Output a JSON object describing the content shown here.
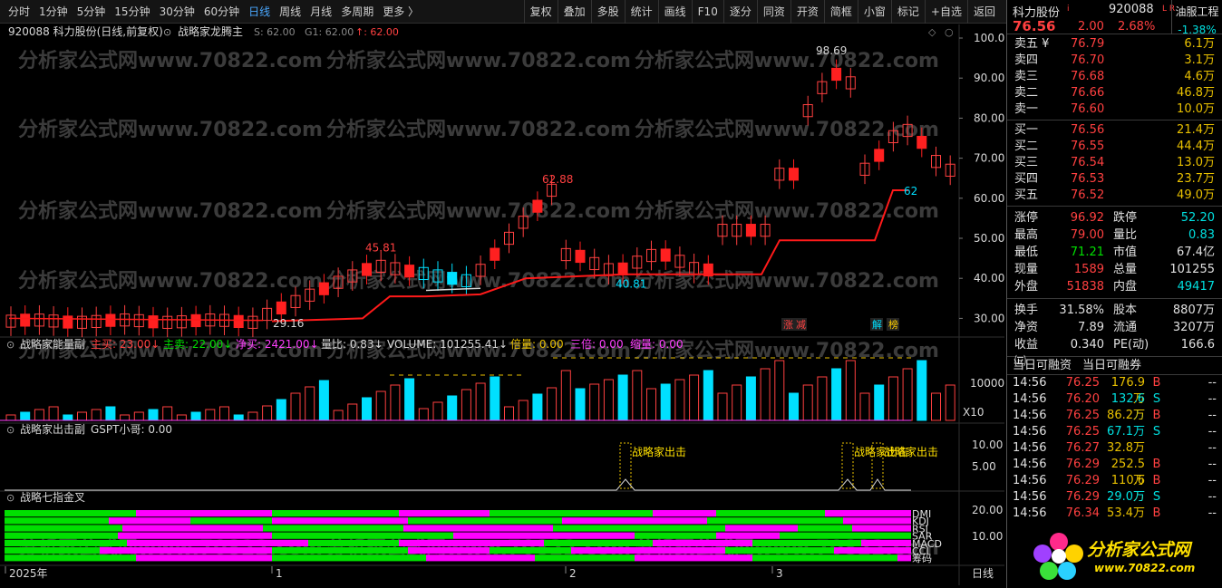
{
  "toolbar": {
    "left": [
      "分时",
      "1分钟",
      "5分钟",
      "15分钟",
      "30分钟",
      "60分钟",
      "日线",
      "周线",
      "月线",
      "多周期",
      "更多 〉"
    ],
    "active": 6,
    "right": [
      "复权",
      "叠加",
      "多股",
      "统计",
      "画线",
      "F10",
      "逐分",
      "同资",
      "开资",
      "简框",
      "小窗",
      "标记",
      "+自选",
      "返回"
    ]
  },
  "price_panel": {
    "header": "920088 科力股份(日线,前复权)",
    "indicator": "战略家龙腾主",
    "header_vals": [
      "S: 62.00",
      "G1: 62.00"
    ],
    "header_red": "↑: 62.00",
    "y_ticks": [
      "100.0",
      "90.00",
      "80.00",
      "70.00",
      "60.00",
      "50.00",
      "40.00",
      "30.00"
    ],
    "labels": [
      "98.69",
      "62.88",
      "45.81",
      "40.81",
      "29.16",
      "62"
    ],
    "tags": [
      "涨",
      "减",
      "解",
      "榜"
    ]
  },
  "vol_panel": {
    "header": "战略家能量副",
    "items": [
      "主买: 23.00↓",
      "主卖: 22.00↓",
      "净买: 2421.00↓",
      "量比: 0.83↓",
      "VOLUME: 101255.41↓",
      "倍量: 0.00",
      "三倍: 0.00",
      "缩量: 0.00"
    ],
    "y_tick": "10000",
    "unit": "X10"
  },
  "hit_panel": {
    "header": "战略家出击副",
    "item": "GSPT小哥: 0.00",
    "y_ticks": [
      "10.00",
      "5.00"
    ],
    "signal": "战略家出击"
  },
  "gold_panel": {
    "header": "战略七指金叉",
    "y_ticks": [
      "20.00",
      "10.00"
    ],
    "rows": [
      "DMI",
      "KDJ",
      "RSI",
      "SAR",
      "MACD",
      "CCI",
      "筹码"
    ]
  },
  "x_axis": {
    "labels": [
      "2025年",
      "1",
      "2",
      "3"
    ],
    "period": "日线"
  },
  "watermark": "分析家公式网www.70822.com",
  "stock": {
    "name": "科力股份",
    "code": "920088",
    "flag": "i",
    "lr": "L R",
    "price": "76.56",
    "change": "2.00",
    "pct": "2.68%",
    "index_name": "油服工程",
    "index_pct": "-1.38%"
  },
  "sell": [
    {
      "label": "卖五 ¥",
      "price": "76.79",
      "vol": "6.1万"
    },
    {
      "label": "卖四",
      "price": "76.70",
      "vol": "3.1万"
    },
    {
      "label": "卖三",
      "price": "76.68",
      "vol": "4.6万"
    },
    {
      "label": "卖二",
      "price": "76.66",
      "vol": "46.8万"
    },
    {
      "label": "卖一",
      "price": "76.60",
      "vol": "10.0万"
    }
  ],
  "buy": [
    {
      "label": "买一",
      "price": "76.56",
      "vol": "21.4万"
    },
    {
      "label": "买二",
      "price": "76.55",
      "vol": "44.4万"
    },
    {
      "label": "买三",
      "price": "76.54",
      "vol": "13.0万"
    },
    {
      "label": "买四",
      "price": "76.53",
      "vol": "23.7万"
    },
    {
      "label": "买五",
      "price": "76.52",
      "vol": "49.0万"
    }
  ],
  "quote1": [
    {
      "l": "涨停",
      "v": "96.92",
      "c": "#ff4040",
      "l2": "跌停",
      "v2": "52.20",
      "c2": "#00e0e0"
    },
    {
      "l": "最高",
      "v": "79.00",
      "c": "#ff4040",
      "l2": "量比",
      "v2": "0.83",
      "c2": "#00e0e0"
    },
    {
      "l": "最低",
      "v": "71.21",
      "c": "#00e000",
      "l2": "市值",
      "v2": "67.4亿",
      "c2": "#e0e0e0"
    },
    {
      "l": "现量",
      "v": "1589",
      "c": "#ff4040",
      "l2": "总量",
      "v2": "101255",
      "c2": "#e0e0e0"
    },
    {
      "l": "外盘",
      "v": "51838",
      "c": "#ff4040",
      "l2": "内盘",
      "v2": "49417",
      "c2": "#00e0e0"
    }
  ],
  "quote2": [
    {
      "l": "换手",
      "v": "31.58%",
      "c": "#e0e0e0",
      "l2": "股本",
      "v2": "8807万",
      "c2": "#e0e0e0"
    },
    {
      "l": "净资",
      "v": "7.89",
      "c": "#e0e0e0",
      "l2": "流通",
      "v2": "3207万",
      "c2": "#e0e0e0"
    },
    {
      "l": "收益㈢",
      "v": "0.340",
      "c": "#e0e0e0",
      "l2": "PE(动)",
      "v2": "166.6",
      "c2": "#e0e0e0"
    }
  ],
  "tabs": [
    "当日可融资",
    "当日可融券"
  ],
  "ticks": [
    {
      "t": "14:56",
      "p": "76.25",
      "v": "176.9万",
      "d": "B"
    },
    {
      "t": "14:56",
      "p": "76.20",
      "v": "132.6万",
      "d": "S"
    },
    {
      "t": "14:56",
      "p": "76.25",
      "v": "86.2万",
      "d": "B"
    },
    {
      "t": "14:56",
      "p": "76.25",
      "v": "67.1万",
      "d": "S"
    },
    {
      "t": "14:56",
      "p": "76.27",
      "v": "32.8万",
      "d": ""
    },
    {
      "t": "14:56",
      "p": "76.29",
      "v": "252.5万",
      "d": "B"
    },
    {
      "t": "14:56",
      "p": "76.29",
      "v": "110.6万",
      "d": "B"
    },
    {
      "t": "14:56",
      "p": "76.29",
      "v": "29.0万",
      "d": "S"
    },
    {
      "t": "14:56",
      "p": "76.34",
      "v": "53.4万",
      "d": "B"
    }
  ],
  "tick_suffix": "--",
  "logo": {
    "text": "分析家公式网",
    "url": "www.70822.com"
  }
}
